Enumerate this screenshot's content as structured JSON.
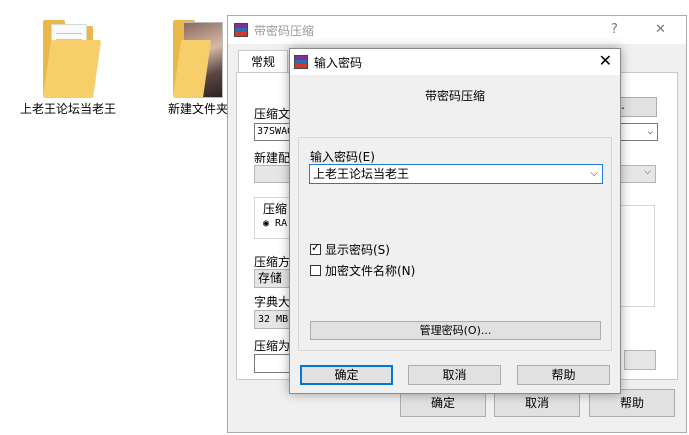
{
  "desktop": {
    "icons": [
      {
        "label": "上老王论坛当老王",
        "kind": "folder-documents"
      },
      {
        "label": "新建文件夹",
        "kind": "folder-photo"
      }
    ]
  },
  "back_dialog": {
    "title": "带密码压缩",
    "help_glyph": "?",
    "close_glyph": "✕",
    "tab": "常规",
    "archive_name_label": "压缩文",
    "archive_name_value": "37SWAG",
    "browse_label": "B)...",
    "new_config_label": "新建配",
    "format_group_label": "压缩",
    "format_radio_label": "RA",
    "method_label": "压缩方",
    "method_value": "存储",
    "dict_label": "字典大",
    "dict_value": "32 MB",
    "split_label": "压缩为",
    "ok": "确定",
    "cancel": "取消",
    "help": "帮助"
  },
  "password_dialog": {
    "title": "输入密码",
    "close_glyph": "✕",
    "heading": "带密码压缩",
    "field_label": "输入密码(E)",
    "password_value": "上老王论坛当老王",
    "show_password_label": "显示密码(S)",
    "show_password_checked": true,
    "encrypt_names_label": "加密文件名称(N)",
    "encrypt_names_checked": false,
    "manage_button": "管理密码(O)...",
    "ok": "确定",
    "cancel": "取消",
    "help": "帮助"
  },
  "colors": {
    "accent": "#0078d7",
    "dialog_bg": "#f0f0f0",
    "folder": "#f7cf6a"
  }
}
